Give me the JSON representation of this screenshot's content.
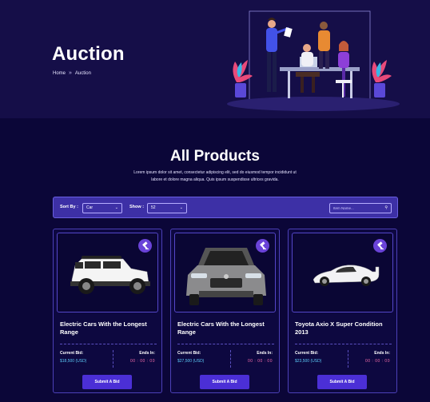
{
  "header": {
    "title": "Auction",
    "breadcrumb": [
      "Home",
      "Auction"
    ],
    "breadcrumb_separator": "»"
  },
  "section": {
    "title": "All Products",
    "description": "Lorem ipsum dolor sit amet, consectetur adipiscing elit, sed do eiusmod tempor incididunt ut labore et dolore magna aliqua. Quis ipsum suspendisse ultrices gravida."
  },
  "filters": {
    "sort_label": "Sort By :",
    "sort_value": "Car",
    "show_label": "Show :",
    "show_value": "52",
    "search_placeholder": "Item Name..."
  },
  "products": [
    {
      "name": "Electric Cars With the Longest Range",
      "bid_label": "Current Bid:",
      "bid_value": "$18,500 (USD)",
      "ends_label": "Ends In:",
      "ends_value": "00 : 00 : 00",
      "button": "Submit A Bid",
      "image": "white-suv"
    },
    {
      "name": "Electric Cars With the Longest Range",
      "bid_label": "Current Bid:",
      "bid_value": "$27,500 (USD)",
      "ends_label": "Ends In:",
      "ends_value": "00 : 00 : 00",
      "button": "Submit A Bid",
      "image": "silver-sedan-front"
    },
    {
      "name": "Toyota Axio X Super Condition 2013",
      "bid_label": "Current Bid:",
      "bid_value": "$23,500 (USD)",
      "ends_label": "Ends In:",
      "ends_value": "00 : 00 : 00",
      "button": "Submit A Bid",
      "image": "white-supercar"
    }
  ],
  "colors": {
    "background": "#0b0638",
    "hero": "#150e48",
    "accent": "#4b2fd6",
    "bid_value": "#5bc8f5",
    "timer": "#f06aa8"
  }
}
